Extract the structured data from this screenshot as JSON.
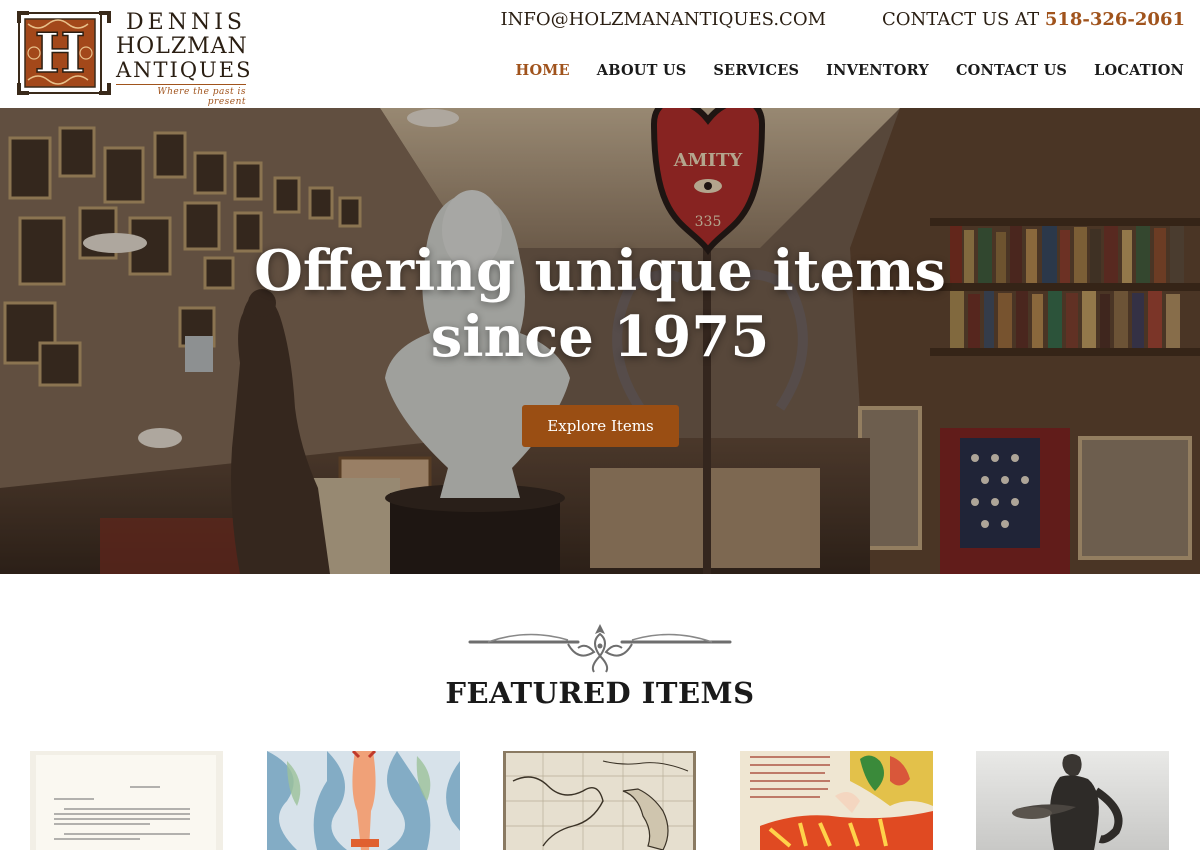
{
  "brand": {
    "line1": "DENNIS",
    "line2": "HOLZMAN",
    "line3": "ANTIQUES",
    "tagline": "Where the past is present",
    "monogram": "H"
  },
  "topbar": {
    "email": "INFO@HOLZMANANTIQUES.COM",
    "contact_prefix": "CONTACT US AT",
    "phone": "518-326-2061"
  },
  "nav": {
    "items": [
      {
        "label": "HOME",
        "active": true
      },
      {
        "label": "ABOUT US",
        "active": false
      },
      {
        "label": "SERVICES",
        "active": false
      },
      {
        "label": "INVENTORY",
        "active": false
      },
      {
        "label": "CONTACT US",
        "active": false
      },
      {
        "label": "LOCATION",
        "active": false
      }
    ]
  },
  "hero": {
    "title_line1": "Offering unique items",
    "title_line2": "since 1975",
    "button": "Explore Items",
    "sign_text": "AMITY",
    "sign_number": "335"
  },
  "featured": {
    "title": "FEATURED ITEMS",
    "items": [
      {
        "name": "letter-item"
      },
      {
        "name": "poster-item"
      },
      {
        "name": "map-item"
      },
      {
        "name": "vietnam-poster-item"
      },
      {
        "name": "bronze-statue-item"
      }
    ]
  },
  "colors": {
    "accent": "#a0531c",
    "button": "#9a4e13",
    "text": "#1a1a1a"
  }
}
